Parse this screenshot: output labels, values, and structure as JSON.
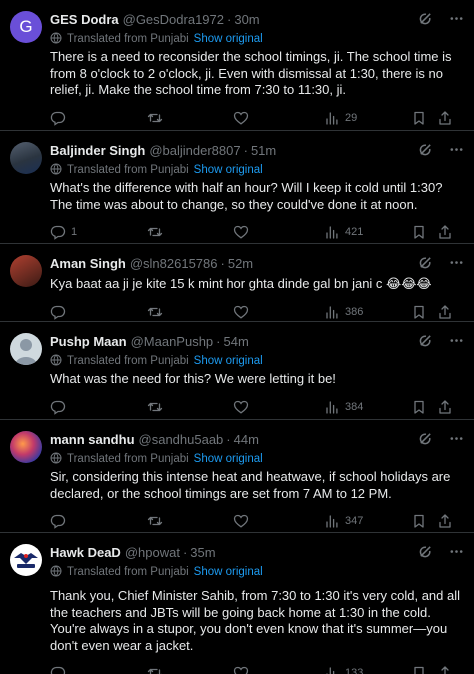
{
  "tweets": [
    {
      "name": "GES Dodra",
      "handle": "@GesDodra1972",
      "time": "30m",
      "avatar_letter": "G",
      "translated": "Translated from Punjabi",
      "show_original": "Show original",
      "text": "There is a need to reconsider the school timings, ji. The school time is from 8 o'clock to 2 o'clock, ji. Even with dismissal at 1:30, there is no relief, ji. Make the school time from 7:30 to 11:30, ji.",
      "replies": "",
      "views": "29"
    },
    {
      "name": "Baljinder Singh",
      "handle": "@baljinder8807",
      "time": "51m",
      "translated": "Translated from Punjabi",
      "show_original": "Show original",
      "text": "What's the difference with half an hour? Will I keep it cold until 1:30? The time was about to change, so they could've done it at noon.",
      "replies": "1",
      "views": "421"
    },
    {
      "name": "Aman Singh",
      "handle": "@sln82615786",
      "time": "52m",
      "text": "Kya baat aa ji je kite 15 k mint hor ghta dinde gal bn jani c 😂😂😂",
      "replies": "",
      "views": "386"
    },
    {
      "name": "Pushp Maan",
      "handle": "@MaanPushp",
      "time": "54m",
      "translated": "Translated from Punjabi",
      "show_original": "Show original",
      "text": "What was the need for this? We were letting it be!",
      "replies": "",
      "views": "384"
    },
    {
      "name": "mann sandhu",
      "handle": "@sandhu5aab",
      "time": "44m",
      "translated": "Translated from Punjabi",
      "show_original": "Show original",
      "text": "Sir, considering this intense heat and heatwave, if school holidays are declared, or the school timings are set from 7 AM to 12 PM.",
      "replies": "",
      "views": "347"
    },
    {
      "name": "Hawk DeaD",
      "handle": "@hpowat",
      "time": "35m",
      "translated": "Translated from Punjabi",
      "show_original": "Show original",
      "text": "Thank you, Chief Minister Sahib, from 7:30 to 1:30 it's very cold, and all the teachers and JBTs will be going back home at 1:30 in the cold. You're always in a stupor, you don't even know that it's summer—you don't even wear a jacket.",
      "replies": "",
      "views": "133"
    }
  ],
  "separator": "·",
  "colors": {
    "background": "#000000",
    "text": "#e7e9ea",
    "muted": "#71767b",
    "link": "#1d9bf0",
    "border": "#2f3336"
  },
  "icons": {
    "grok": "grok-icon",
    "more": "more-icon",
    "translate": "translate-icon",
    "reply": "reply-icon",
    "retweet": "retweet-icon",
    "like": "like-icon",
    "views": "views-icon",
    "bookmark": "bookmark-icon",
    "share": "share-icon"
  }
}
